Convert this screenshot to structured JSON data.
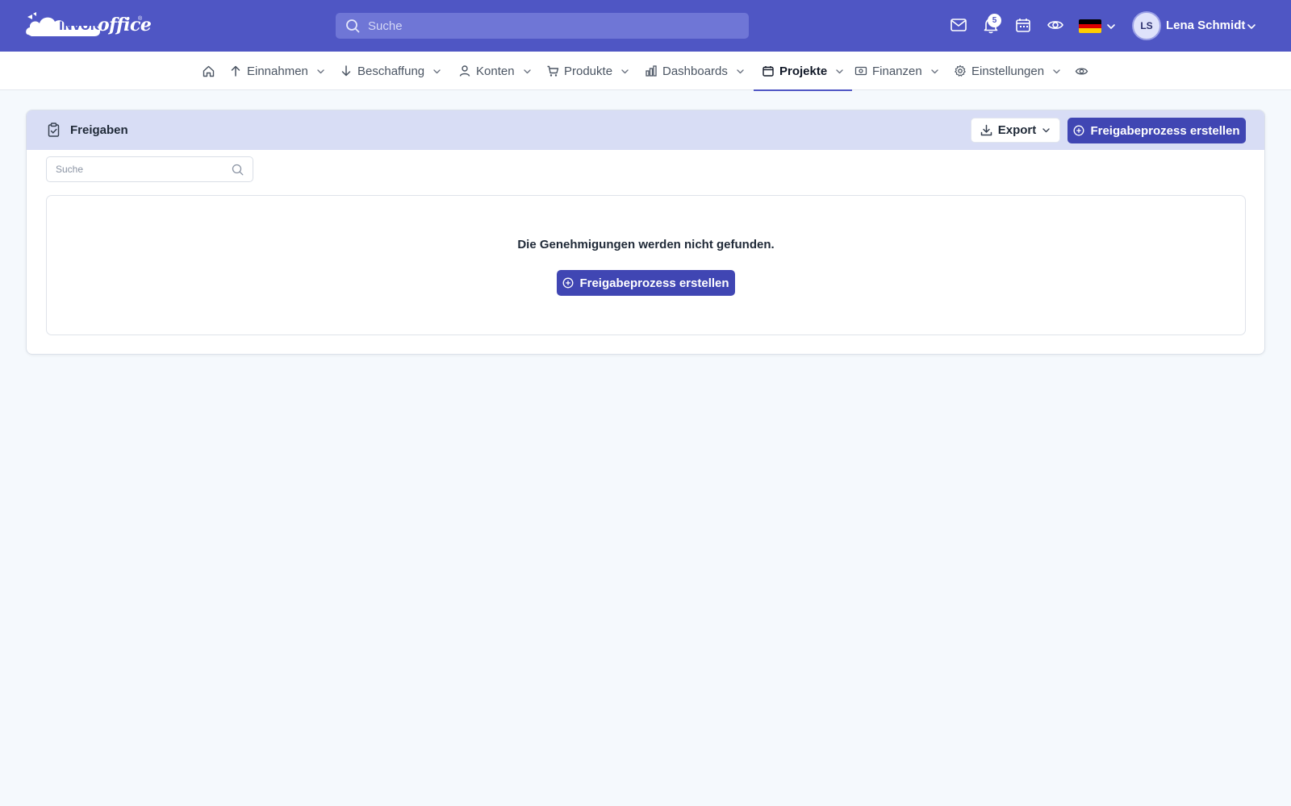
{
  "header": {
    "logo_text": "INVOICE",
    "logo_office": "office",
    "logo_reg": "®",
    "search_placeholder": "Suche",
    "notification_count": "5",
    "user_initials": "LS",
    "user_name": "Lena Schmidt",
    "icons": [
      "mail-icon",
      "bell-icon",
      "calendar-icon",
      "eye-icon",
      "flag-de-icon",
      "chevron-down-icon"
    ],
    "flag_colors": [
      "#000000",
      "#dd0000",
      "#ffce00"
    ]
  },
  "nav": {
    "items": [
      {
        "label": "",
        "icon": "home-icon"
      },
      {
        "label": "Einnahmen",
        "icon": "arrow-up-icon"
      },
      {
        "label": "Beschaffung",
        "icon": "arrow-down-icon"
      },
      {
        "label": "Konten",
        "icon": "user-icon"
      },
      {
        "label": "Produkte",
        "icon": "cart-icon"
      },
      {
        "label": "Dashboards",
        "icon": "bar-chart-icon"
      },
      {
        "label": "Projekte",
        "icon": "calendar-icon",
        "active": true
      },
      {
        "label": "Finanzen",
        "icon": "money-icon"
      },
      {
        "label": "Einstellungen",
        "icon": "gear-icon"
      },
      {
        "label": "",
        "icon": "eye-icon"
      }
    ]
  },
  "panel": {
    "title": "Freigaben",
    "export_label": "Export",
    "create_label": "Freigabeprozess erstellen",
    "search_placeholder": "Suche",
    "empty_message": "Die Genehmigungen werden nicht gefunden.",
    "empty_create_label": "Freigabeprozess erstellen"
  },
  "colors": {
    "brand": "#4f56c4",
    "primary_button": "#4046b3",
    "panel_header": "#d8ddf5",
    "page_background": "#f5f9fd"
  }
}
